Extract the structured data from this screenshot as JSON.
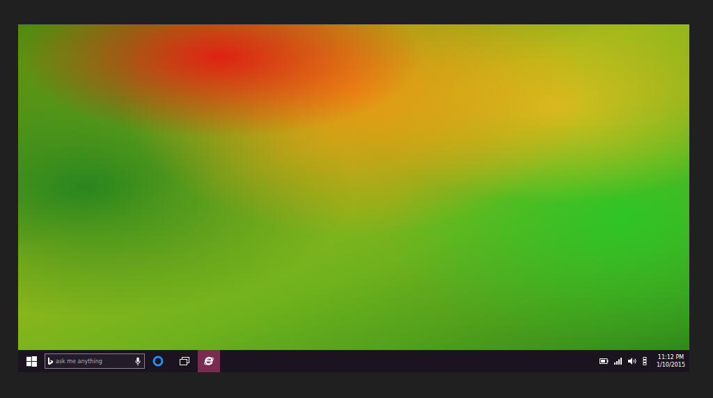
{
  "taskbar": {
    "search": {
      "placeholder": "ask me anything"
    },
    "apps": [
      {
        "selected": true
      }
    ],
    "clock": {
      "time": "11:12 PM",
      "date": "1/10/2015"
    }
  }
}
